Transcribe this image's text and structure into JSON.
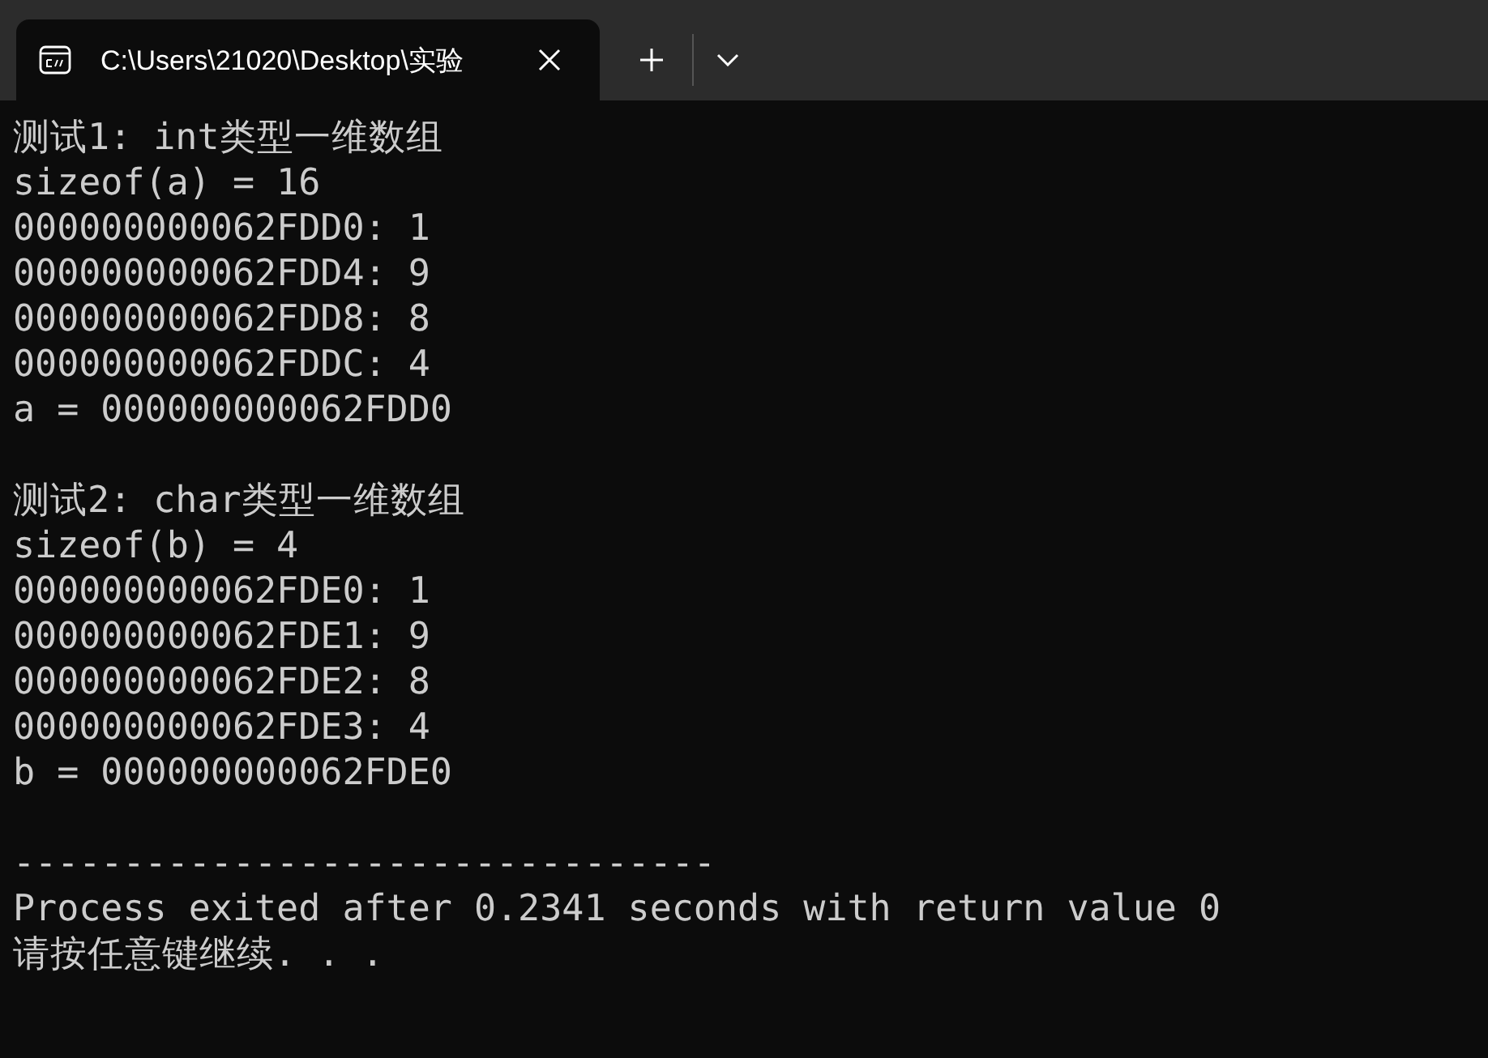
{
  "tab": {
    "title": "C:\\Users\\21020\\Desktop\\实验",
    "selected": true
  },
  "output_blocks": [
    [
      "测试1: int类型一维数组",
      "sizeof(a) = 16",
      "000000000062FDD0: 1",
      "000000000062FDD4: 9",
      "000000000062FDD8: 8",
      "000000000062FDDC: 4",
      "a = 000000000062FDD0"
    ],
    [
      "测试2: char类型一维数组",
      "sizeof(b) = 4",
      "000000000062FDE0: 1",
      "000000000062FDE1: 9",
      "000000000062FDE2: 8",
      "000000000062FDE3: 4",
      "b = 000000000062FDE0"
    ],
    [
      "--------------------------------",
      "Process exited after 0.2341 seconds with return value 0",
      "请按任意键继续. . ."
    ]
  ]
}
